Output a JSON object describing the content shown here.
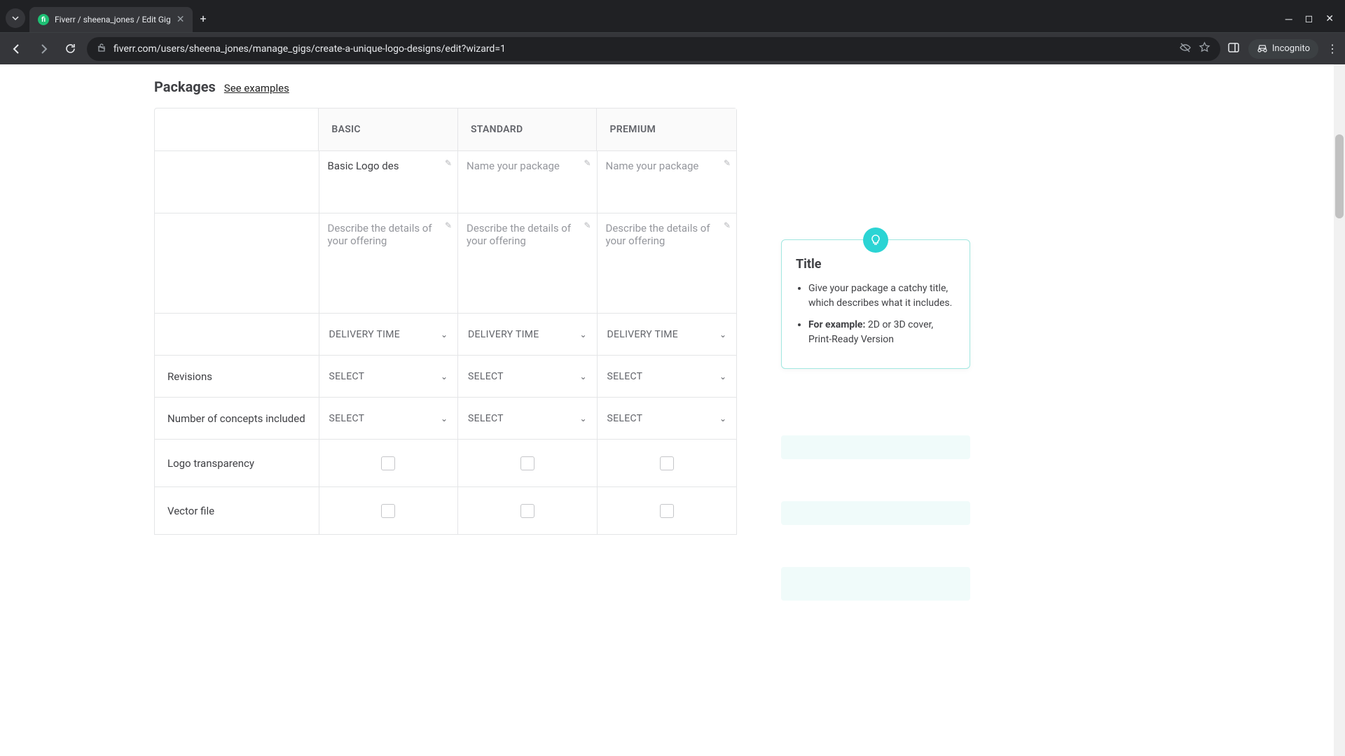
{
  "browser": {
    "tab_title": "Fiverr / sheena_jones / Edit Gig",
    "url": "fiverr.com/users/sheena_jones/manage_gigs/create-a-unique-logo-designs/edit?wizard=1",
    "incognito_label": "Incognito"
  },
  "header": {
    "title": "Packages",
    "see_examples": "See examples"
  },
  "columns": {
    "basic": "BASIC",
    "standard": "STANDARD",
    "premium": "PREMIUM"
  },
  "inputs": {
    "basic_name_value": "Basic Logo des",
    "name_placeholder": "Name your package",
    "desc_placeholder": "Describe the details of your offering",
    "delivery_label": "DELIVERY TIME",
    "select_label": "SELECT"
  },
  "rows": {
    "revisions": "Revisions",
    "concepts": "Number of concepts included",
    "transparency": "Logo transparency",
    "vector": "Vector file"
  },
  "tip": {
    "title": "Title",
    "bullet1": "Give your package a catchy title, which describes what it includes.",
    "bullet2_prefix": "For example:",
    "bullet2_rest": " 2D or 3D cover, Print-Ready Version"
  }
}
